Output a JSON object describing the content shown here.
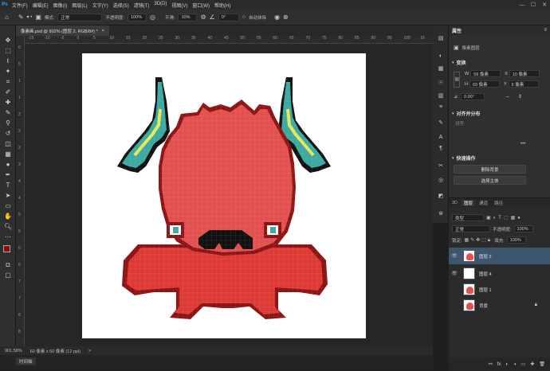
{
  "menubar": {
    "logo": "Ps",
    "items": [
      "文件(F)",
      "编辑(E)",
      "图像(I)",
      "图层(L)",
      "文字(Y)",
      "选择(S)",
      "滤镜(T)",
      "3D(D)",
      "视图(V)",
      "窗口(W)",
      "帮助(H)"
    ],
    "window_buttons": [
      "—",
      "☐",
      "✕"
    ]
  },
  "options": {
    "fill_label": "模式:",
    "mode_value": "正常",
    "opacity_label": "不透明度:",
    "opacity_value": "100%",
    "smooth_label": "平滑:",
    "smooth_value": "10%",
    "angle_value": "0°",
    "auto_erase_label": "自动抹除"
  },
  "document": {
    "tab_title": "像素画.psd @ 902% (图层 2, RGB/8#) *",
    "close": "×"
  },
  "ruler": {
    "top_ticks": [
      "-15",
      "-10",
      "-5",
      "0",
      "5",
      "10",
      "15",
      "20",
      "25",
      "30",
      "35",
      "40",
      "45",
      "50",
      "55",
      "60",
      "65",
      "70",
      "75",
      "80",
      "85",
      "90",
      "95",
      "100",
      "10"
    ],
    "left_ticks": [
      "0",
      "5",
      "1",
      "1",
      "2",
      "2",
      "3",
      "3",
      "4",
      "4",
      "5",
      "5",
      "6",
      "6",
      "7",
      "7",
      "8",
      "8"
    ]
  },
  "status": {
    "zoom": "901.58%",
    "doc_size": "60 像素 x 60 像素 (12 ppi)",
    "arrow": ">"
  },
  "bottom": {
    "timeline_label": "时间轴"
  },
  "properties": {
    "panel_title": "属性",
    "menu_icon": "≡",
    "section_pixel_layer": "像素图层",
    "transform_title": "变换",
    "w_label": "W",
    "w_value": "59 像素",
    "x_label": "X",
    "x_value": "10 像素",
    "h_label": "H",
    "h_value": "69 像素",
    "y_label": "Y",
    "y_value": "6 像素",
    "angle_value": "0.00°",
    "align_title": "对齐并分布",
    "align_label": "对齐:",
    "more": "•••",
    "quick_title": "快速操作",
    "remove_bg": "删除背景",
    "select_subject": "选择主体"
  },
  "layers": {
    "tabs": [
      "3D",
      "图层",
      "通道",
      "路径"
    ],
    "kind_label": "类型",
    "blend_mode": "正常",
    "opacity_label": "不透明度:",
    "opacity_value": "100%",
    "lock_label": "锁定:",
    "fill_label": "填充:",
    "fill_value": "100%",
    "rows": [
      {
        "name": "图层 2",
        "selected": true,
        "visible": true
      },
      {
        "name": "图层 4",
        "selected": false,
        "visible": true
      },
      {
        "name": "图层 1",
        "selected": false,
        "visible": false
      },
      {
        "name": "背景",
        "selected": false,
        "visible": false
      }
    ],
    "footer_icons": [
      "⚯",
      "fx",
      "◐",
      "◑",
      "▭",
      "✚",
      "🗑"
    ]
  },
  "colors": {
    "foreground": "#8b0d0d",
    "background": "#ffffff",
    "monster_body": "#e2514f",
    "monster_outline": "#8c1414",
    "horn_teal": "#3ea9a0",
    "horn_yellow": "#e4e85a"
  }
}
